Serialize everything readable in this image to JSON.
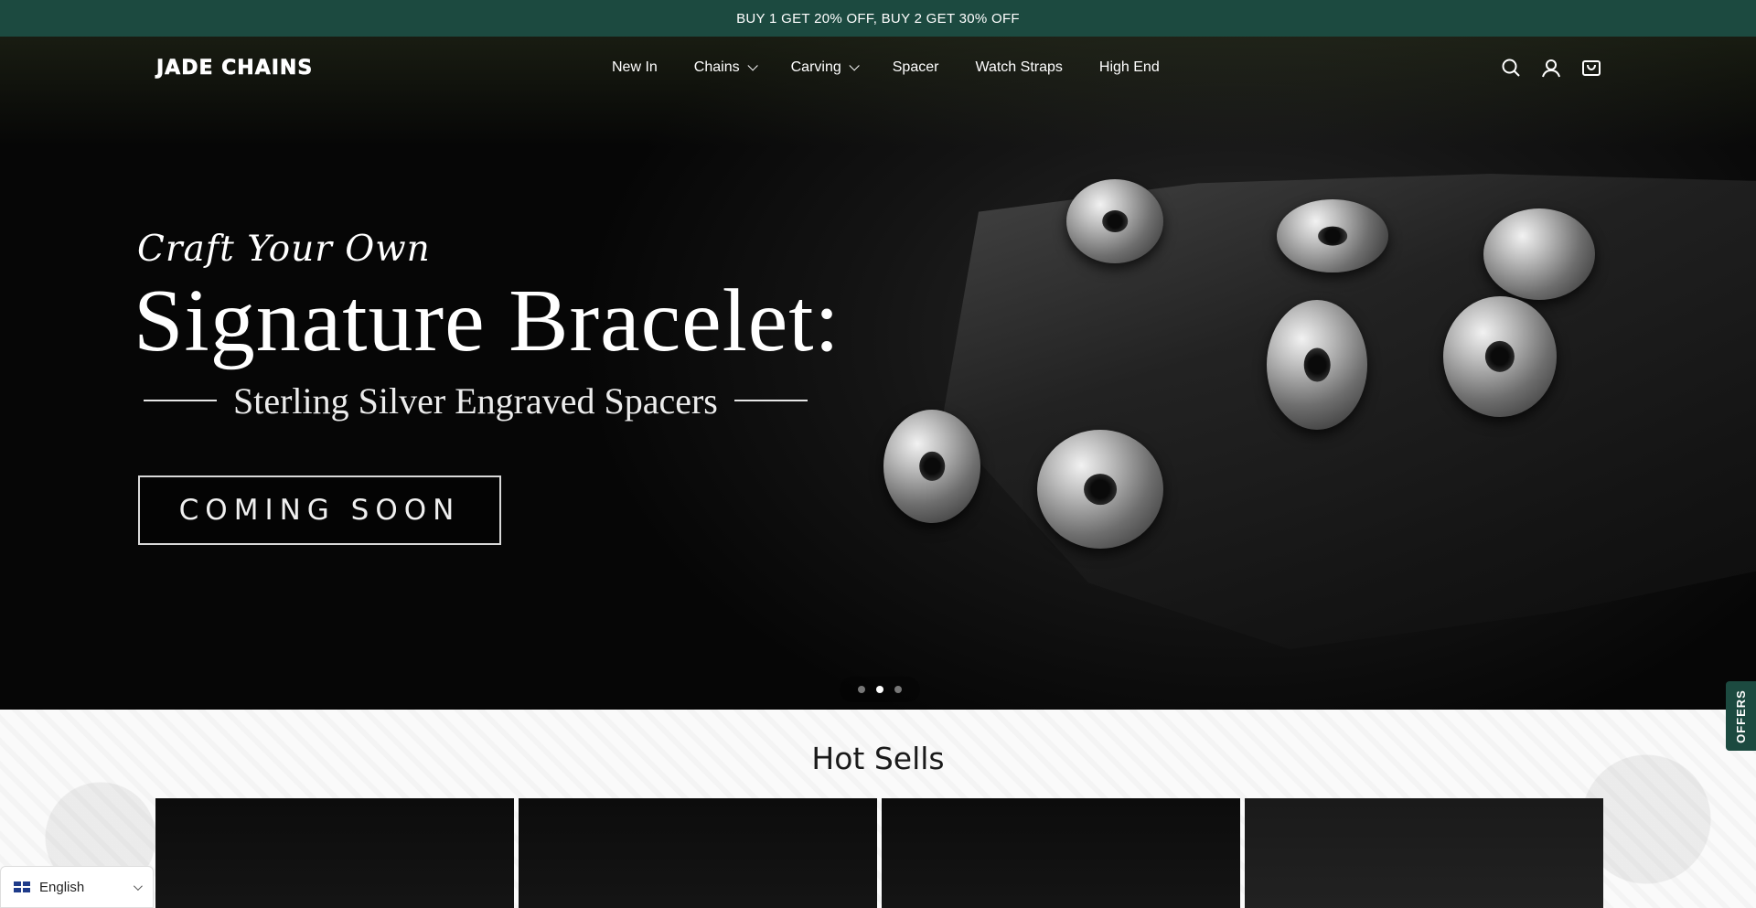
{
  "announcement": {
    "text": "BUY 1 GET 20% OFF, BUY 2 GET 30% OFF"
  },
  "header": {
    "logo_text": "JADE CHAINS",
    "nav": [
      {
        "label": "New In",
        "has_dropdown": false
      },
      {
        "label": "Chains",
        "has_dropdown": true
      },
      {
        "label": "Carving",
        "has_dropdown": true
      },
      {
        "label": "Spacer",
        "has_dropdown": false
      },
      {
        "label": "Watch Straps",
        "has_dropdown": false
      },
      {
        "label": "High End",
        "has_dropdown": false
      }
    ],
    "icons": [
      "search-icon",
      "account-icon",
      "cart-icon"
    ]
  },
  "hero": {
    "kicker": "Craft Your Own",
    "headline": "Signature Bracelet:",
    "subline": "Sterling Silver Engraved Spacers",
    "cta": "COMING SOON",
    "slides_total": 3,
    "active_slide": 2
  },
  "hot_sells": {
    "title": "Hot Sells",
    "cards_visible": 4
  },
  "offers_tab": {
    "label": "OFFERS"
  },
  "language": {
    "selected": "English"
  },
  "colors": {
    "announcement_bg": "#1c4a40",
    "hero_bg": "#050505",
    "text_light": "#ffffff"
  }
}
